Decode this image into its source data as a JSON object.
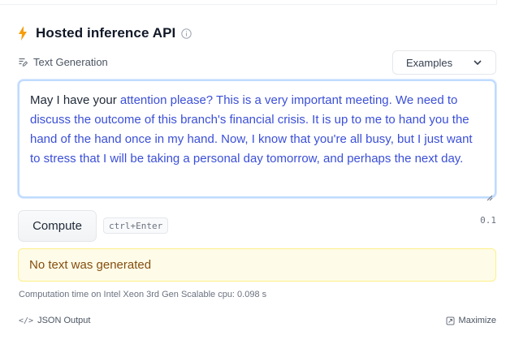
{
  "widget": {
    "title": "Hosted inference API",
    "task_label": "Text Generation",
    "examples_label": "Examples"
  },
  "editor": {
    "prompt_text": "May I have your ",
    "generated_text": "attention please? This is a very important meeting. We need to discuss the outcome of this branch's financial crisis. It is up to me to hand you the hand of the hand once in my hand. Now, I know that you're all busy, but I just want to stress that I will be taking a personal day tomorrow, and perhaps the next day."
  },
  "actions": {
    "compute_label": "Compute",
    "shortcut": "ctrl+Enter",
    "elapsed": "0.1"
  },
  "alert": {
    "message": "No text was generated"
  },
  "footer": {
    "computation_time": "Computation time on Intel Xeon 3rd Gen Scalable cpu: 0.098 s",
    "json_output_label": "JSON Output",
    "maximize_label": "Maximize"
  },
  "colors": {
    "accent_bolt": "#f59e0b",
    "generated_text": "#3b4fd8",
    "alert_bg": "#fefce8",
    "alert_text": "#854d0e"
  },
  "icons": {
    "title": "lightning-icon",
    "info": "info-icon",
    "task": "text-generation-icon",
    "dropdown": "chevron-down-icon",
    "json": "code-icon",
    "maximize": "maximize-icon"
  }
}
